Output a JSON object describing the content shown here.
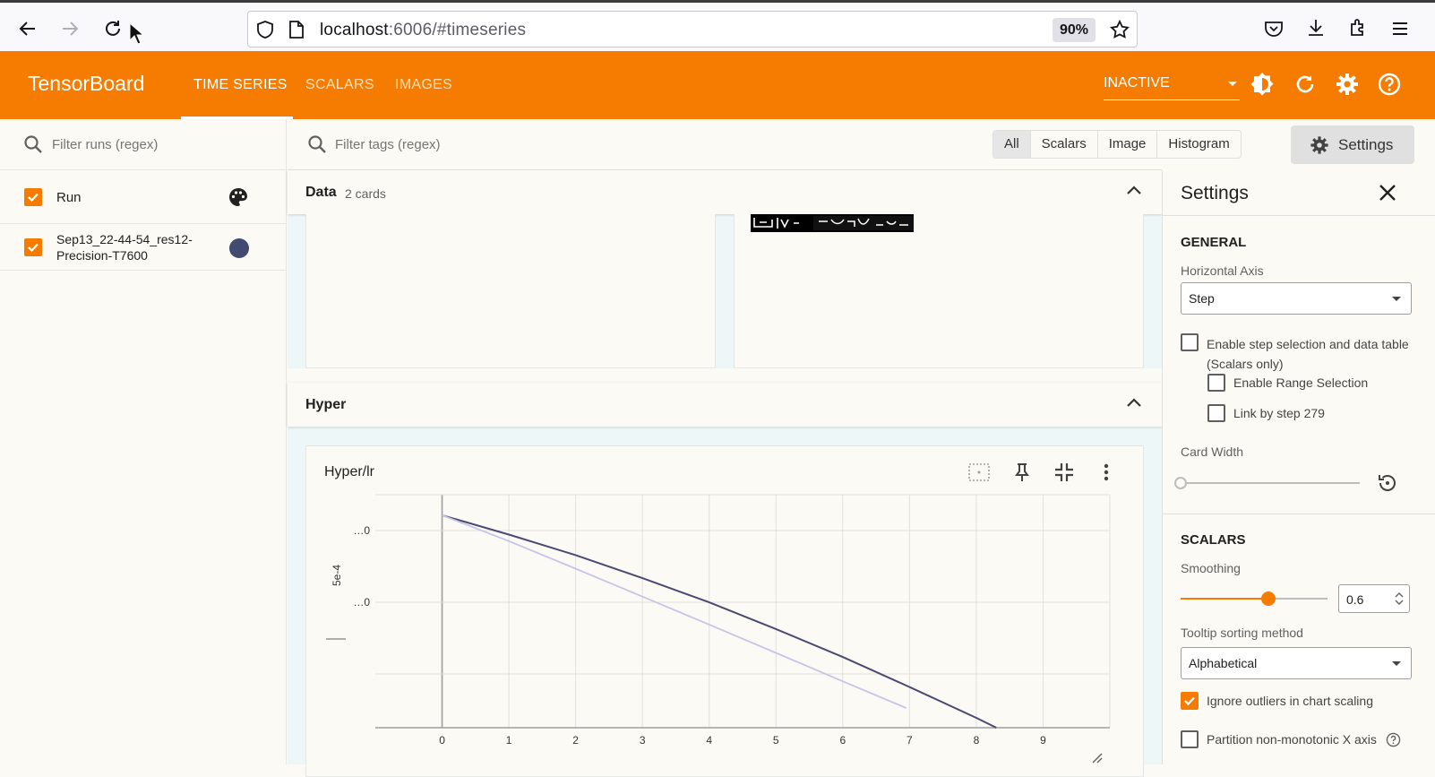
{
  "browser": {
    "url_host": "localhost",
    "url_rest": ":6006/#timeseries",
    "zoom": "90%"
  },
  "header": {
    "logo": "TensorBoard",
    "tabs": [
      {
        "label": "TIME SERIES",
        "active": true
      },
      {
        "label": "SCALARS",
        "active": false
      },
      {
        "label": "IMAGES",
        "active": false
      }
    ],
    "status_select": "INACTIVE",
    "accent_color": "#f57c00"
  },
  "runs": {
    "filter_placeholder": "Filter runs (regex)",
    "header_label": "Run",
    "items": [
      {
        "name_line1": "Sep13_22-44-54_res12-",
        "name_line2": "Precision-T7600",
        "color": "#424a72"
      }
    ]
  },
  "main": {
    "tags_filter_placeholder": "Filter tags (regex)",
    "type_filters": [
      "All",
      "Scalars",
      "Image",
      "Histogram"
    ],
    "settings_button": "Settings",
    "groups": [
      {
        "name": "Data",
        "count": "2 cards"
      },
      {
        "name": "Hyper"
      }
    ],
    "card_title": "Hyper/lr"
  },
  "chart_data": {
    "type": "line",
    "title": "Hyper/lr",
    "ylabel": "5e-4",
    "y_tick_labels": [
      "…0",
      "…0"
    ],
    "x_ticks": [
      0,
      1,
      2,
      3,
      4,
      5,
      6,
      7,
      8,
      9
    ],
    "xlim": [
      -1,
      10
    ],
    "grid": true,
    "series": [
      {
        "color": "#4a4a72",
        "x": [
          0,
          1,
          2,
          3,
          4,
          5,
          6,
          7,
          8,
          8.3
        ],
        "y": [
          0.0,
          -0.047,
          -0.097,
          -0.153,
          -0.212,
          -0.277,
          -0.345,
          -0.418,
          -0.493,
          -0.517
        ]
      },
      {
        "color": "#c9c3ea",
        "x": [
          0,
          1,
          2,
          3,
          4,
          5,
          6,
          6.95
        ],
        "y": [
          0.0,
          -0.063,
          -0.13,
          -0.198,
          -0.266,
          -0.335,
          -0.404,
          -0.469
        ]
      }
    ]
  },
  "settings": {
    "title": "Settings",
    "general_section": "GENERAL",
    "horizontal_axis_label": "Horizontal Axis",
    "horizontal_axis_value": "Step",
    "step_selection_line1": "Enable step selection and data table",
    "step_selection_line2": "(Scalars only)",
    "range_selection": "Enable Range Selection",
    "link_by_step": "Link by step 279",
    "card_width_label": "Card Width",
    "scalars_section": "SCALARS",
    "smoothing_label": "Smoothing",
    "smoothing_value": "0.6",
    "smoothing_fraction": 0.6,
    "tooltip_sort_label": "Tooltip sorting method",
    "tooltip_sort_value": "Alphabetical",
    "ignore_outliers": "Ignore outliers in chart scaling",
    "partition_axis": "Partition non-monotonic X axis"
  }
}
